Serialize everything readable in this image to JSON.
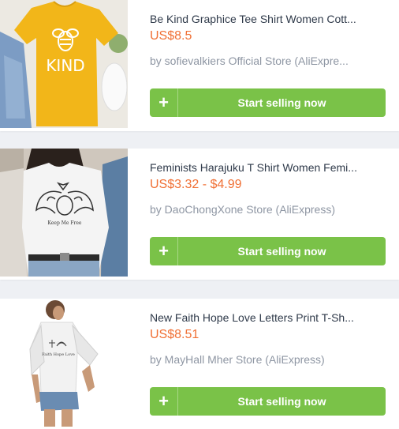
{
  "products": [
    {
      "title": "Be Kind Graphice Tee Shirt Women Cott...",
      "price": "US$8.5",
      "store": "by sofievalkiers Official Store (AliExpre...",
      "button_label": "Start selling now",
      "button_icon": "plus-icon",
      "image_text": "KIND"
    },
    {
      "title": "Feminists Harajuku T Shirt Women Femi...",
      "price": "US$3.32 - $4.99",
      "store": "by DaoChongXone Store (AliExpress)",
      "button_label": "Start selling now",
      "button_icon": "plus-icon",
      "image_text": "Keep Me Free"
    },
    {
      "title": "New Faith Hope Love Letters Print T-Sh...",
      "price": "US$8.51",
      "store": "by MayHall Mher Store (AliExpress)",
      "button_label": "Start selling now",
      "button_icon": "plus-icon",
      "image_text": "Faith Hope Love"
    }
  ],
  "colors": {
    "price": "#f07035",
    "button": "#7ac248",
    "title": "#2f3a4a",
    "store": "#8e96a3",
    "page_bg": "#eef0f4"
  }
}
